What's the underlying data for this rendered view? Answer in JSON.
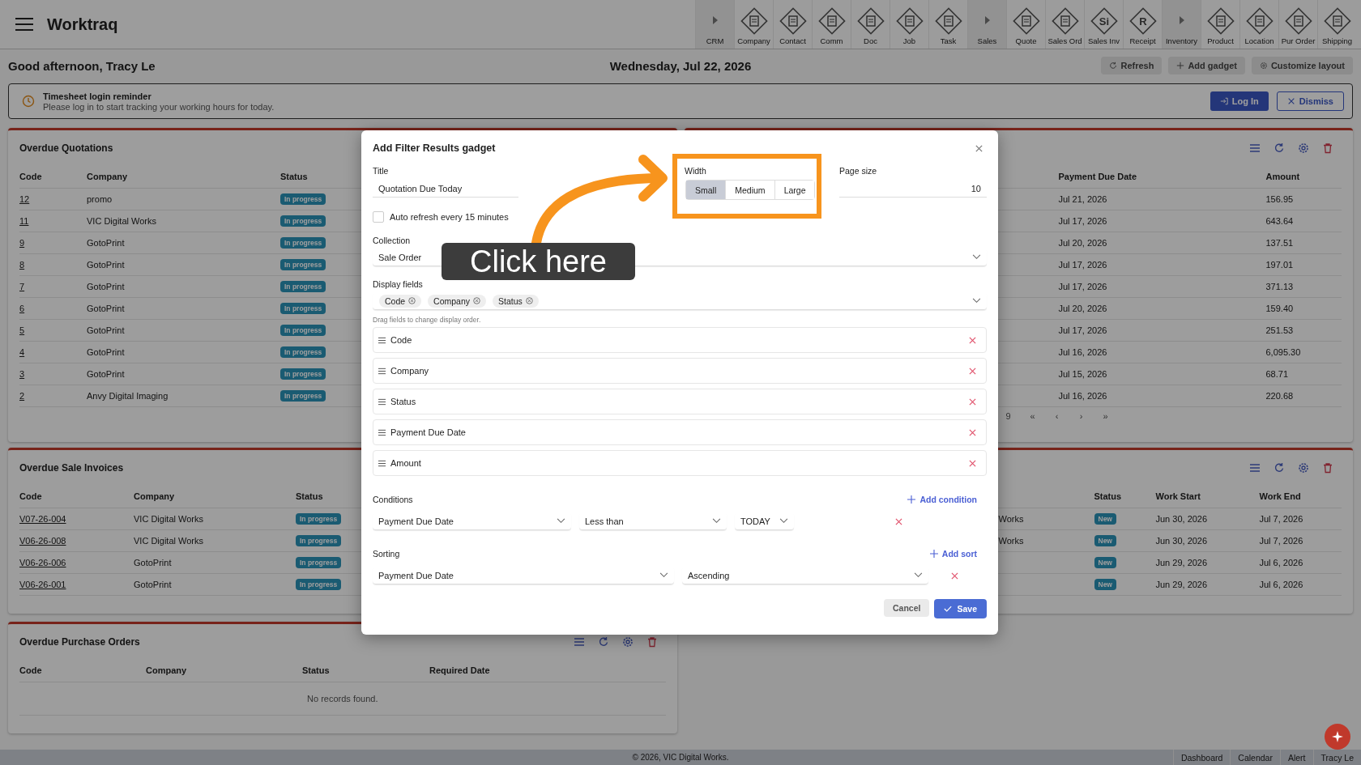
{
  "app": {
    "title": "Worktraq"
  },
  "nav": [
    {
      "label": "CRM",
      "kind": "group"
    },
    {
      "label": "Company",
      "kind": "app"
    },
    {
      "label": "Contact",
      "kind": "app"
    },
    {
      "label": "Comm",
      "kind": "app"
    },
    {
      "label": "Doc",
      "kind": "app"
    },
    {
      "label": "Job",
      "kind": "app"
    },
    {
      "label": "Task",
      "kind": "app"
    },
    {
      "label": "Sales",
      "kind": "group"
    },
    {
      "label": "Quote",
      "kind": "app"
    },
    {
      "label": "Sales Ord",
      "kind": "app"
    },
    {
      "label": "Sales Inv",
      "kind": "app",
      "glyph": "Si"
    },
    {
      "label": "Receipt",
      "kind": "app",
      "glyph": "R"
    },
    {
      "label": "Inventory",
      "kind": "group"
    },
    {
      "label": "Product",
      "kind": "app"
    },
    {
      "label": "Location",
      "kind": "app"
    },
    {
      "label": "Pur Order",
      "kind": "app"
    },
    {
      "label": "Shipping",
      "kind": "app"
    }
  ],
  "greeting": "Good afternoon, Tracy Le",
  "date": "Wednesday, Jul 22, 2026",
  "actions": [
    {
      "label": "Refresh",
      "kind": "refresh"
    },
    {
      "label": "Add gadget",
      "kind": "add"
    },
    {
      "label": "Customize layout",
      "kind": "settings"
    }
  ],
  "reminder": {
    "title": "Timesheet login reminder",
    "text": "Please log in to start tracking your working hours for today.",
    "login": "Log In",
    "dismiss": "Dismiss"
  },
  "left_panels": [
    {
      "title": "Overdue Quotations",
      "columns": [
        {
          "label": "Code",
          "kind": "link"
        },
        {
          "label": "Company",
          "kind": "text"
        },
        {
          "label": "Status",
          "kind": "badge"
        }
      ],
      "rows": [
        [
          "12",
          "promo",
          "In progress"
        ],
        [
          "11",
          "VIC Digital Works",
          "In progress"
        ],
        [
          "9",
          "GotoPrint",
          "In progress"
        ],
        [
          "8",
          "GotoPrint",
          "In progress"
        ],
        [
          "7",
          "GotoPrint",
          "In progress"
        ],
        [
          "6",
          "GotoPrint",
          "In progress"
        ],
        [
          "5",
          "GotoPrint",
          "In progress"
        ],
        [
          "4",
          "GotoPrint",
          "In progress"
        ],
        [
          "3",
          "GotoPrint",
          "In progress"
        ],
        [
          "2",
          "Anvy Digital Imaging",
          "In progress"
        ]
      ]
    },
    {
      "title": "Overdue Sale Invoices",
      "columns": [
        {
          "label": "Code",
          "kind": "link"
        },
        {
          "label": "Company",
          "kind": "text"
        },
        {
          "label": "Status",
          "kind": "badge"
        }
      ],
      "rows": [
        [
          "V07-26-004",
          "VIC Digital Works",
          "In progress"
        ],
        [
          "V06-26-008",
          "VIC Digital Works",
          "In progress"
        ],
        [
          "V06-26-006",
          "GotoPrint",
          "In progress"
        ],
        [
          "V06-26-001",
          "GotoPrint",
          "In progress"
        ]
      ]
    },
    {
      "title": "Overdue Purchase Orders",
      "tools": true,
      "columns": [
        {
          "label": "Code"
        },
        {
          "label": "Company"
        },
        {
          "label": "Status"
        },
        {
          "label": "Required Date"
        }
      ],
      "empty": "No records found."
    }
  ],
  "right_panels": [
    {
      "tools": true,
      "columns": [
        {
          "label": "Payment Due Date",
          "kind": "text"
        },
        {
          "label": "Amount",
          "kind": "text"
        }
      ],
      "rows": [
        [
          "Jul 21, 2026",
          "156.95"
        ],
        [
          "Jul 17, 2026",
          "643.64"
        ],
        [
          "Jul 20, 2026",
          "137.51"
        ],
        [
          "Jul 17, 2026",
          "197.01"
        ],
        [
          "Jul 17, 2026",
          "371.13"
        ],
        [
          "Jul 20, 2026",
          "159.40"
        ],
        [
          "Jul 17, 2026",
          "251.53"
        ],
        [
          "Jul 16, 2026",
          "6,095.30"
        ],
        [
          "Jul 15, 2026",
          "68.71"
        ],
        [
          "Jul 16, 2026",
          "220.68"
        ]
      ],
      "pagination": {
        "fragment": "9",
        "controls": [
          "«",
          "‹",
          "›",
          "»"
        ]
      }
    },
    {
      "tools": true,
      "columns": [
        {
          "kind": "text"
        },
        {
          "label": "Status",
          "kind": "badge"
        },
        {
          "label": "Work Start",
          "kind": "text"
        },
        {
          "label": "Work End",
          "kind": "text"
        }
      ],
      "rows": [
        [
          "Works",
          "New",
          "Jun 30, 2026",
          "Jul 7, 2026"
        ],
        [
          "Works",
          "New",
          "Jun 30, 2026",
          "Jul 7, 2026"
        ],
        [
          null,
          "New",
          "Jun 29, 2026",
          "Jul 6, 2026"
        ],
        [
          null,
          "New",
          "Jun 29, 2026",
          "Jul 6, 2026"
        ]
      ]
    }
  ],
  "modal": {
    "title": "Add Filter Results gadget",
    "title_field": {
      "label": "Title",
      "value": "Quotation Due Today"
    },
    "width": {
      "label": "Width",
      "options": [
        {
          "label": "Small",
          "selected": true
        },
        {
          "label": "Medium",
          "selected": false
        },
        {
          "label": "Large",
          "selected": false
        }
      ]
    },
    "page_size": {
      "label": "Page size",
      "value": "10"
    },
    "auto_refresh": {
      "label": "Auto refresh every 15 minutes",
      "checked": false
    },
    "collection": {
      "label": "Collection",
      "value": "Sale Order"
    },
    "display_fields": {
      "label": "Display fields",
      "chips": [
        "Code",
        "Company",
        "Status"
      ],
      "hint": "Drag fields to change display order.",
      "items": [
        "Code",
        "Company",
        "Status",
        "Payment Due Date",
        "Amount"
      ]
    },
    "conditions": {
      "label": "Conditions",
      "add": "Add condition",
      "rows": [
        [
          "Payment Due Date",
          "Less than",
          "TODAY"
        ]
      ]
    },
    "sorting": {
      "label": "Sorting",
      "add": "Add sort",
      "rows": [
        [
          "Payment Due Date",
          "Ascending"
        ]
      ]
    },
    "cancel": "Cancel",
    "save": "Save"
  },
  "annotation": {
    "label": "Click here"
  },
  "footer": {
    "copyright": "© 2026, VIC Digital Works.",
    "links": [
      "Dashboard",
      "Calendar",
      "Alert",
      "Tracy Le"
    ]
  }
}
